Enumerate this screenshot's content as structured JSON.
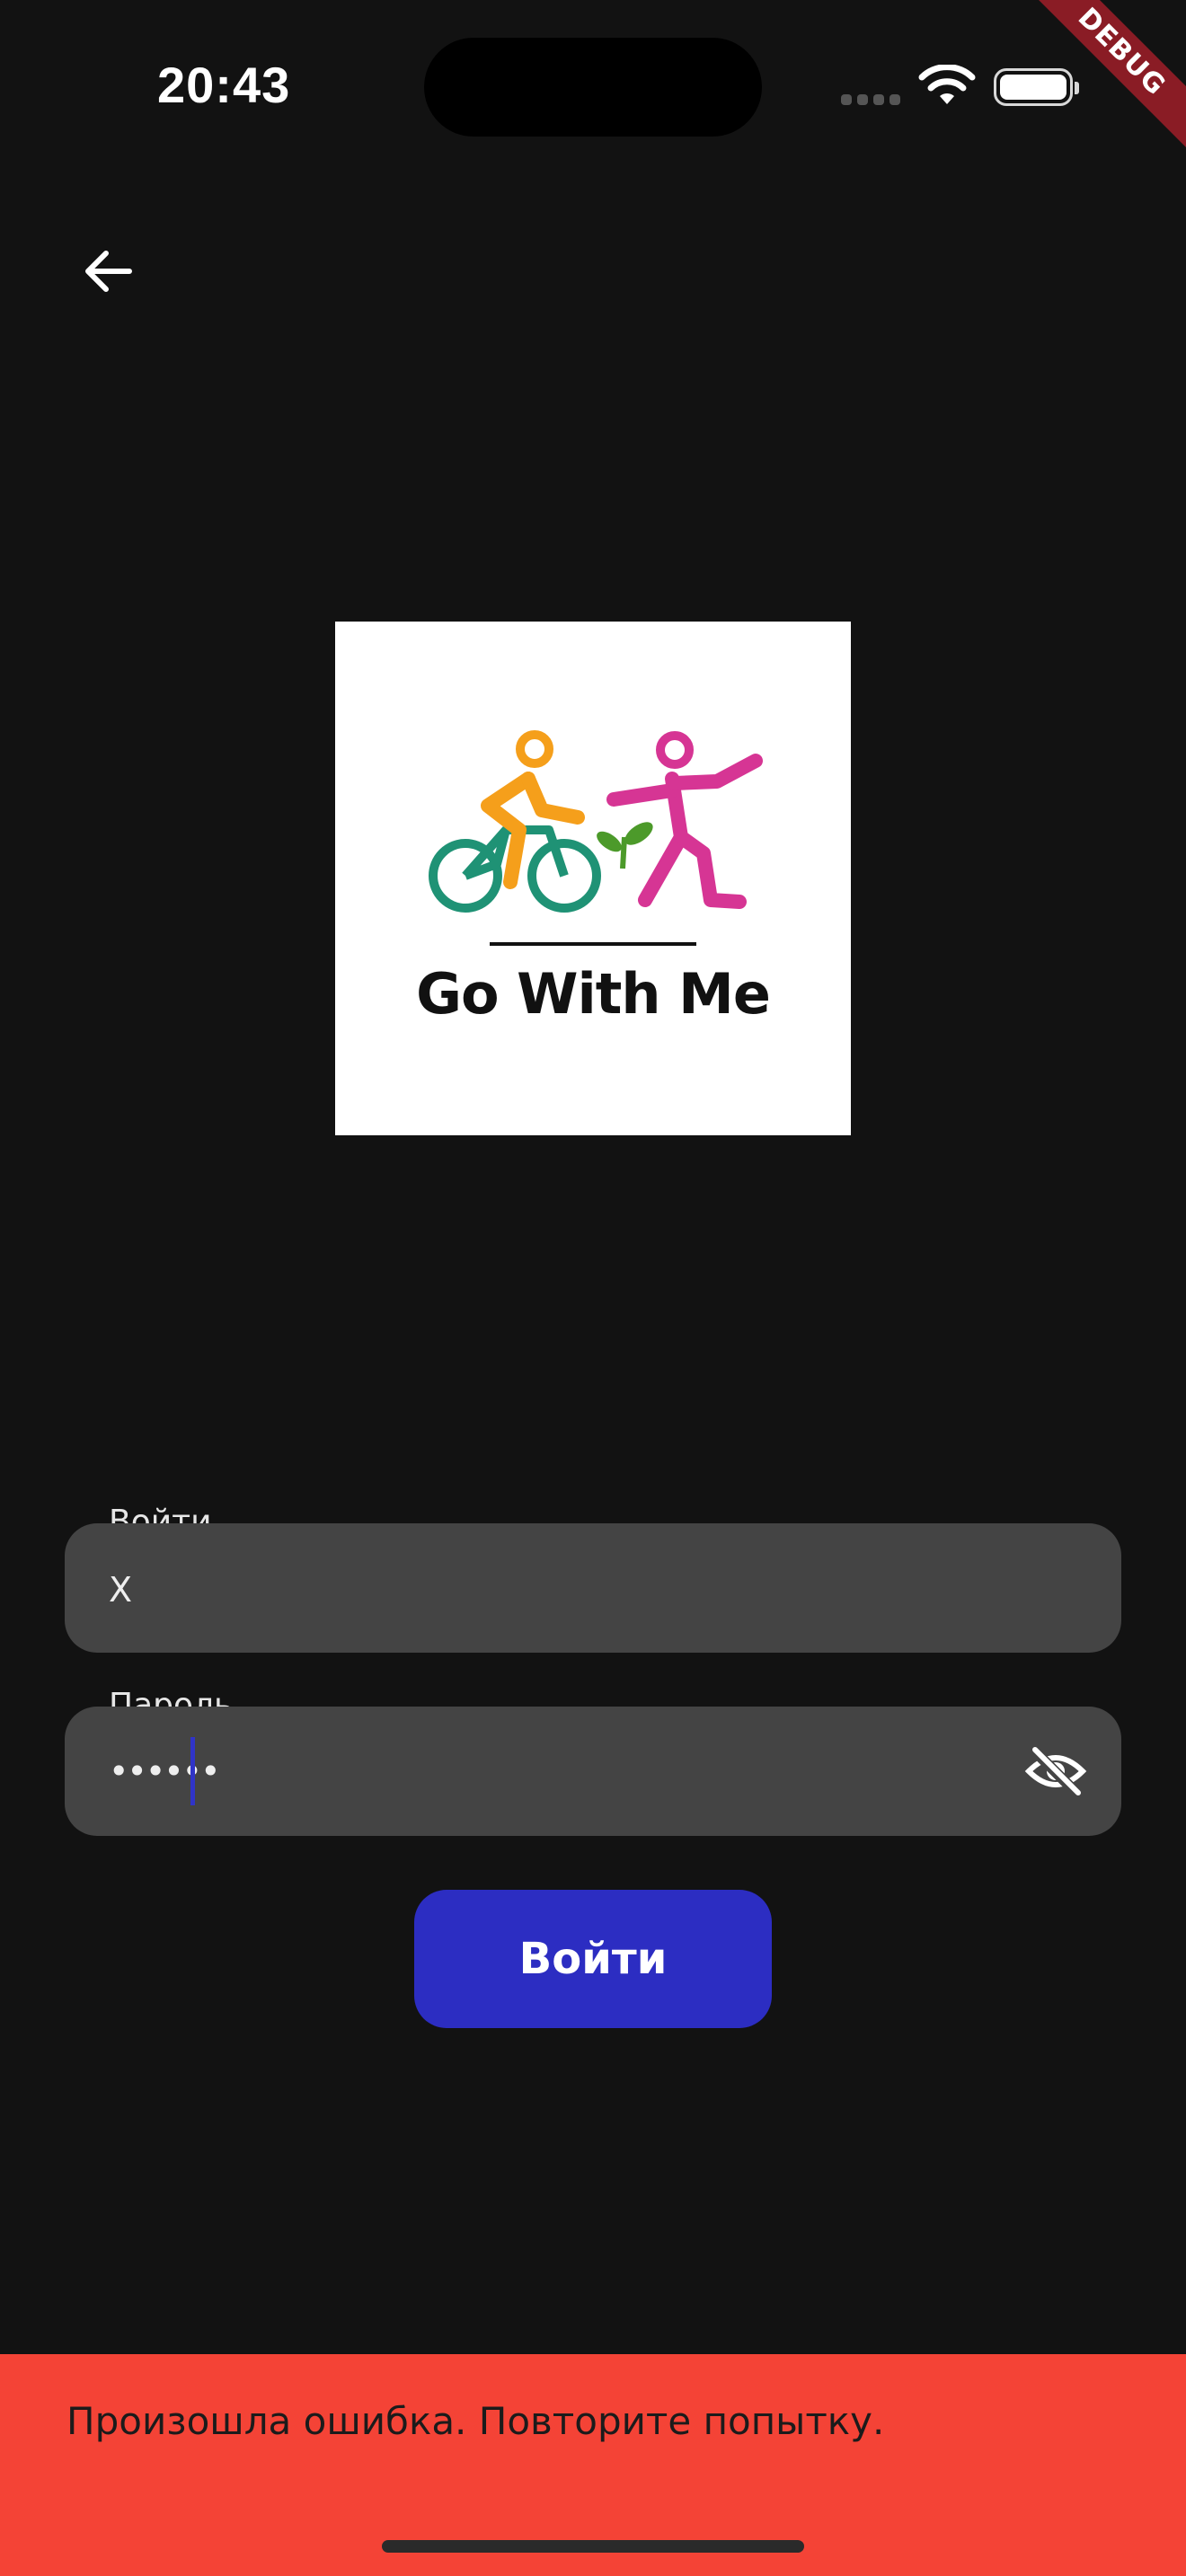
{
  "status_bar": {
    "time": "20:43"
  },
  "debug_banner": "DEBUG",
  "logo": {
    "title": "Go With Me"
  },
  "login_field": {
    "label": "Войти",
    "value": "X"
  },
  "password_field": {
    "label": "Пароль",
    "value": "••••••"
  },
  "login_button": {
    "label": "Войти"
  },
  "snackbar": {
    "message": "Произошла ошибка. Повторите попытку."
  },
  "colors": {
    "background": "#121212",
    "field": "#444444",
    "button": "#2c2dc2",
    "snackbar": "#f44336"
  }
}
